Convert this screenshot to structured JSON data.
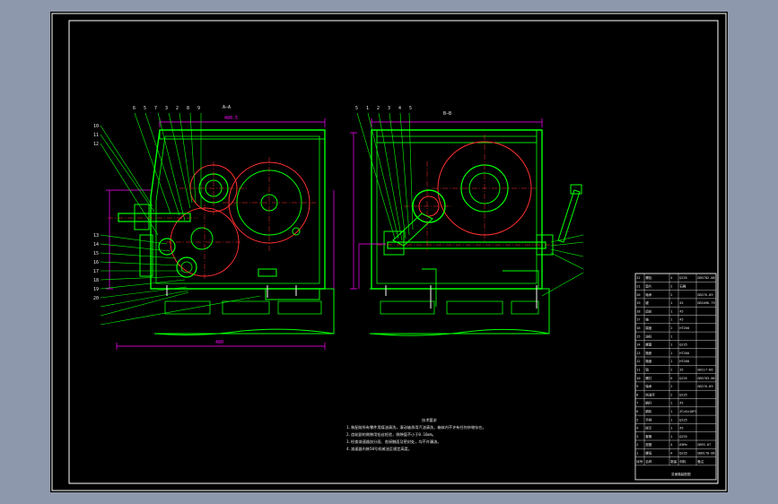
{
  "colors": {
    "background": "#8e98ac",
    "sheet": "#000000",
    "frame": "#ffffff",
    "outline": "#00ff00",
    "center_line": "#ff3030",
    "dimension": "#ff00ff",
    "leader": "#00ff00"
  },
  "views": {
    "left_title": "A—A",
    "right_title": "B—B"
  },
  "left_callouts": [
    "6",
    "5",
    "7",
    "3",
    "2",
    "8",
    "9"
  ],
  "right_callouts": [
    "5",
    "1",
    "2",
    "3",
    "4",
    "5"
  ],
  "left_side_labels": [
    "10",
    "11",
    "12",
    "13",
    "14",
    "15",
    "16",
    "17",
    "18",
    "19",
    "20"
  ],
  "technical_requirements": {
    "heading": "技术要求",
    "lines": [
      "1.装配前所有零件用煤油清洗，滚动轴承用汽油清洗，箱体内不许有任何杂物存在。",
      "2.齿轮副的侧隙用铅丝检验，侧隙值不小于0.16mm。",
      "3.检查减速器剖分面、各接触面及密封处，均不许漏油。",
      "4.减速器内装50号机械油至规定高度。"
    ]
  },
  "parts_table": {
    "rows": [
      [
        "22",
        "螺栓",
        "4",
        "Q235",
        "GB5782-86"
      ],
      [
        "21",
        "垫片",
        "2",
        "石棉",
        ""
      ],
      [
        "20",
        "轴承",
        "2",
        "",
        "GB276-89"
      ],
      [
        "19",
        "键",
        "1",
        "45",
        "GB1096-79"
      ],
      [
        "18",
        "齿轮",
        "1",
        "45",
        ""
      ],
      [
        "17",
        "轴",
        "1",
        "45",
        ""
      ],
      [
        "16",
        "端盖",
        "2",
        "HT200",
        ""
      ],
      [
        "15",
        "油标",
        "1",
        "",
        ""
      ],
      [
        "14",
        "螺塞",
        "1",
        "Q235",
        ""
      ],
      [
        "13",
        "箱座",
        "1",
        "HT200",
        ""
      ],
      [
        "12",
        "箱盖",
        "1",
        "HT200",
        ""
      ],
      [
        "11",
        "销",
        "2",
        "35",
        "GB117-86"
      ],
      [
        "10",
        "螺钉",
        "6",
        "Q235",
        "GB5783-86"
      ],
      [
        "9",
        "轴承",
        "2",
        "",
        "GB276-89"
      ],
      [
        "8",
        "挡油环",
        "2",
        "Q235",
        ""
      ],
      [
        "7",
        "蜗杆",
        "1",
        "45",
        ""
      ],
      [
        "6",
        "蜗轮",
        "1",
        "ZCuSn10P1",
        ""
      ],
      [
        "5",
        "手柄",
        "1",
        "Q235",
        ""
      ],
      [
        "4",
        "拨叉",
        "1",
        "45",
        ""
      ],
      [
        "3",
        "套筒",
        "1",
        "Q235",
        ""
      ],
      [
        "2",
        "垫圈",
        "4",
        "65Mn",
        "GB93-87"
      ],
      [
        "1",
        "螺母",
        "4",
        "Q235",
        "GB6170-86"
      ]
    ],
    "header": [
      "序号",
      "名称",
      "数量",
      "材料",
      "备注"
    ],
    "title_block": "变速箱装配图"
  }
}
